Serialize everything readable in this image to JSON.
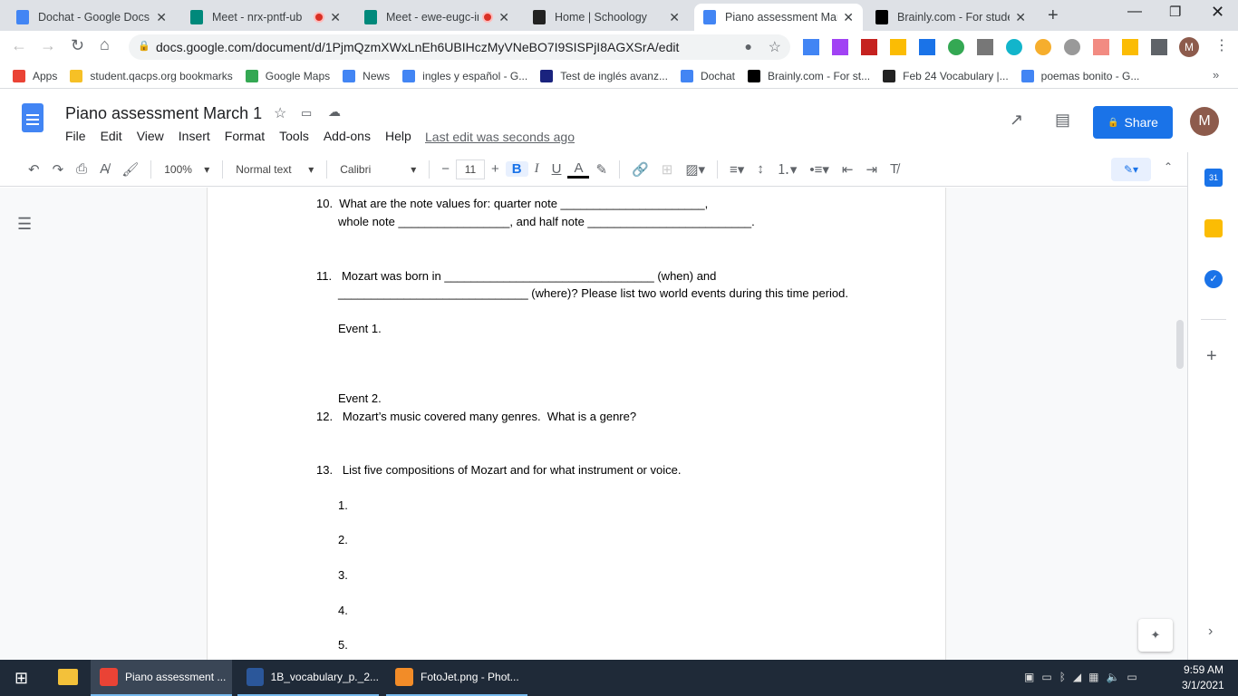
{
  "tabs": [
    {
      "title": "Dochat - Google Docs",
      "icon": "docs-icon",
      "color": "#4285f4"
    },
    {
      "title": "Meet - nrx-pntf-ub",
      "icon": "meet-icon",
      "color": "#00897b",
      "recording": true
    },
    {
      "title": "Meet - ewe-eugc-ir",
      "icon": "meet-icon",
      "color": "#00897b",
      "recording": true
    },
    {
      "title": "Home | Schoology",
      "icon": "schoology-icon",
      "color": "#222"
    },
    {
      "title": "Piano assessment Marc",
      "icon": "docs-icon",
      "color": "#4285f4",
      "active": true
    },
    {
      "title": "Brainly.com - For studer",
      "icon": "brainly-icon",
      "color": "#000"
    }
  ],
  "url": "docs.google.com/document/d/1PjmQzmXWxLnEh6UBIHczMyVNeBO7I9SISPjI8AGXSrA/edit",
  "profile_initial": "M",
  "bookmarks": [
    {
      "label": "Apps",
      "color": "#ea4335"
    },
    {
      "label": "student.qacps.org bookmarks",
      "color": "#f6c026"
    },
    {
      "label": "Google Maps",
      "color": "#34a853"
    },
    {
      "label": "News",
      "color": "#4285f4"
    },
    {
      "label": "ingles y español - G...",
      "color": "#4285f4"
    },
    {
      "label": "Test de inglés avanz...",
      "color": "#1a237e"
    },
    {
      "label": "Dochat",
      "color": "#4285f4"
    },
    {
      "label": "Brainly.com - For st...",
      "color": "#000"
    },
    {
      "label": "Feb 24 Vocabulary |...",
      "color": "#222"
    },
    {
      "label": "poemas bonito - G...",
      "color": "#4285f4"
    }
  ],
  "doc": {
    "title": "Piano assessment March 1",
    "menu": [
      "File",
      "Edit",
      "View",
      "Insert",
      "Format",
      "Tools",
      "Add-ons",
      "Help"
    ],
    "last_edit": "Last edit was seconds ago",
    "share": "Share"
  },
  "toolbar": {
    "zoom": "100%",
    "style": "Normal text",
    "font": "Calibri",
    "size": "11"
  },
  "content": [
    "10.  What are the note values for: quarter note ______________________,",
    "whole note _________________, and half note _________________________.",
    "11.   Mozart was born in ________________________________ (when) and",
    "_____________________________ (where)? Please list two world events during this time period.",
    "Event 1.",
    "Event 2.",
    "12.   Mozart’s music covered many genres.  What is a genre?",
    "13.   List five compositions of Mozart and for what instrument or voice.",
    "1.",
    "2.",
    "3.",
    "4.",
    "5."
  ],
  "taskbar": {
    "items": [
      {
        "label": "Piano assessment ...",
        "color": "#ea4335"
      },
      {
        "label": "1B_vocabulary_p._2...",
        "color": "#2b579a"
      },
      {
        "label": "FotoJet.png - Phot...",
        "color": "#f28c28"
      }
    ],
    "time": "9:59 AM",
    "date": "3/1/2021"
  }
}
